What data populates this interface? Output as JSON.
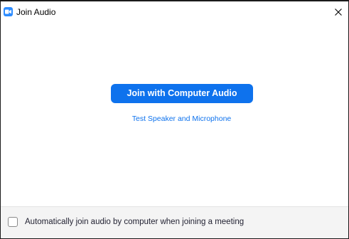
{
  "window": {
    "title": "Join Audio",
    "app_icon": "zoom-video-icon",
    "close_icon": "close-icon"
  },
  "main": {
    "join_button_label": "Join with Computer Audio",
    "test_link_label": "Test Speaker and Microphone"
  },
  "footer": {
    "auto_join_label": "Automatically join audio by computer when joining a meeting",
    "auto_join_checked": false
  },
  "colors": {
    "accent": "#0e72ed",
    "app_icon": "#2d8cff",
    "footer_bg": "#f4f4f4"
  }
}
